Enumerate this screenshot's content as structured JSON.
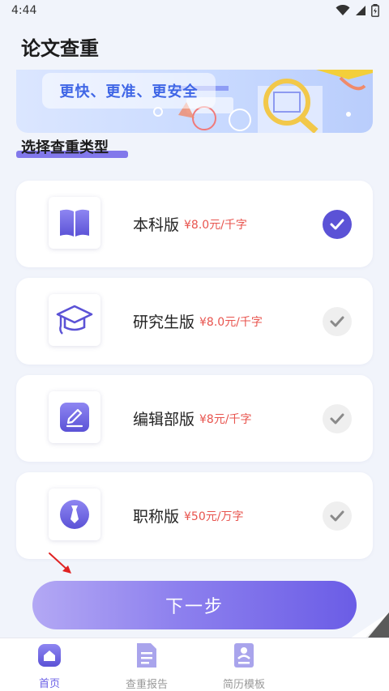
{
  "status_bar": {
    "time": "4:44"
  },
  "header": {
    "title": "论文查重"
  },
  "banner": {
    "tagline": "更快、更准、更安全"
  },
  "section": {
    "title": "选择查重类型"
  },
  "options": [
    {
      "name": "本科版",
      "price": "¥8.0元/千字",
      "icon": "book-icon",
      "selected": true
    },
    {
      "name": "研究生版",
      "price": "¥8.0元/千字",
      "icon": "graduation-cap-icon",
      "selected": false
    },
    {
      "name": "编辑部版",
      "price": "¥8元/千字",
      "icon": "edit-icon",
      "selected": false
    },
    {
      "name": "职称版",
      "price": "¥50元/万字",
      "icon": "tie-icon",
      "selected": false
    }
  ],
  "next_button": {
    "label": "下一步"
  },
  "bottom_nav": {
    "items": [
      {
        "label": "首页",
        "icon": "home-icon",
        "active": true
      },
      {
        "label": "查重报告",
        "icon": "document-icon",
        "active": false
      },
      {
        "label": "简历模板",
        "icon": "resume-icon",
        "active": false
      }
    ]
  },
  "colors": {
    "accent": "#5b52d6",
    "price": "#e8544e",
    "background": "#f1f4fb",
    "banner_text": "#3f66e6"
  }
}
